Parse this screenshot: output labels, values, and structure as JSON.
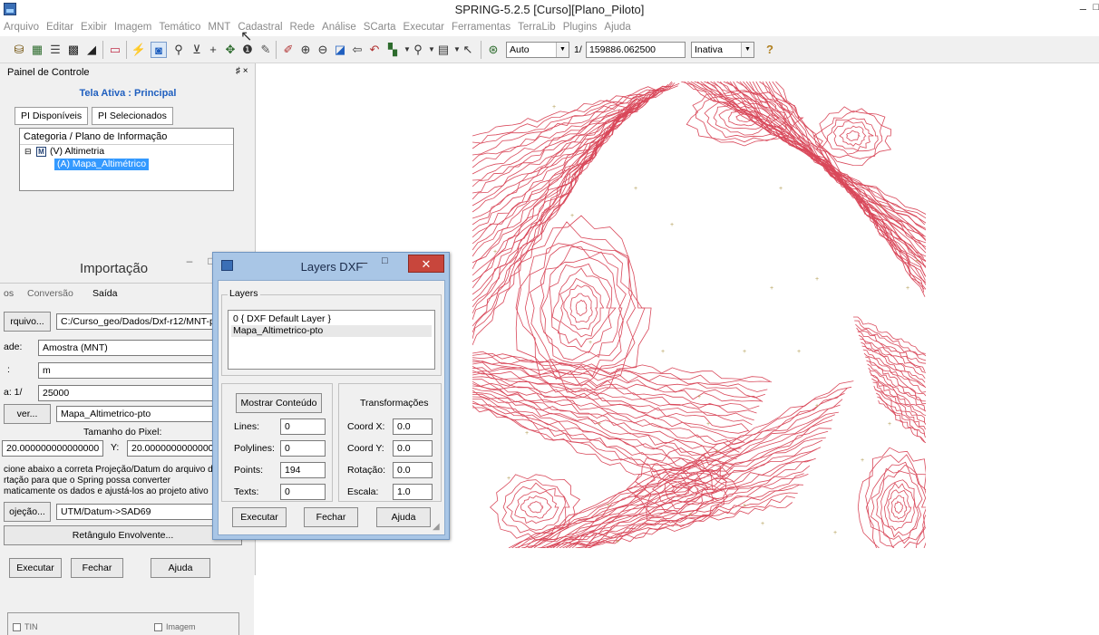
{
  "window": {
    "title": "SPRING-5.2.5 [Curso][Plano_Piloto]",
    "min": "–",
    "max": "□"
  },
  "menu": [
    "Arquivo",
    "Editar",
    "Exibir",
    "Imagem",
    "Temático",
    "MNT",
    "Cadastral",
    "Rede",
    "Análise",
    "SCarta",
    "Executar",
    "Ferramentas",
    "TerraLib",
    "Plugins",
    "Ajuda"
  ],
  "toolbar": {
    "zoom_mode": "Auto",
    "scale_prefix": "1/",
    "scale_value": "159886.062500",
    "status": "Inativa",
    "help": "?"
  },
  "control_panel": {
    "title": "Painel de Controle",
    "pin": "♯ ×",
    "active_screen": "Tela Ativa : Principal",
    "tabs": [
      "PI Disponíveis",
      "PI Selecionados"
    ],
    "tree_header": "Categoria / Plano de Informação",
    "tree_category": "(V) Altimetria",
    "tree_category_badge": "M",
    "tree_plan": "(A) Mapa_Altimétrico",
    "check_tin": "TIN",
    "check_image": "Imagem"
  },
  "import_window": {
    "title": "Importação",
    "tabs": [
      "os",
      "Conversão",
      "Saída"
    ],
    "file_button": "rquivo...",
    "file_path": "C:/Curso_geo/Dados/Dxf-r12/MNT-pto",
    "entity_label": "ade:",
    "entity_value": "Amostra (MNT)",
    "unit_label": ":",
    "unit_value": "m",
    "scale_label": "a: 1/",
    "scale_value": "25000",
    "pi_button": "ver...",
    "pi_value": "Mapa_Altimetrico-pto",
    "pixel_size_label": "Tamanho do Pixel:",
    "pixel_x": "20.000000000000000",
    "pixel_y_label": "Y:",
    "pixel_y": "20.0000000000000",
    "note_lines": [
      "cione abaixo a correta Projeção/Datum do arquivo d",
      "rtação para que o Spring possa converter",
      "maticamente os dados e ajustá-los ao projeto ativo"
    ],
    "projection_button": "ojeção...",
    "projection_value": "UTM/Datum->SAD69",
    "bbox_button": "Retângulo Envolvente...",
    "execute": "Executar",
    "close": "Fechar",
    "help": "Ajuda"
  },
  "layers_dialog": {
    "title": "Layers DXF",
    "close": "✕",
    "layers_group": "Layers",
    "layers": [
      "0 { DXF Default Layer }",
      "Mapa_Altimetrico-pto"
    ],
    "show_content": "Mostrar Conteúdo",
    "lines_label": "Lines:",
    "lines": "0",
    "polylines_label": "Polylines:",
    "polylines": "0",
    "points_label": "Points:",
    "points": "194",
    "texts_label": "Texts:",
    "texts": "0",
    "transform_title": "Transformações",
    "coordx_label": "Coord X:",
    "coordx": "0.0",
    "coordy_label": "Coord Y:",
    "coordy": "0.0",
    "rotation_label": "Rotação:",
    "rotation": "0.0",
    "scale_label": "Escala:",
    "scale": "1.0",
    "execute": "Executar",
    "close_btn": "Fechar",
    "help": "Ajuda"
  },
  "map": {
    "contour_color": "#d9485a",
    "point_marker": "+",
    "point_color": "#b5a05a"
  }
}
